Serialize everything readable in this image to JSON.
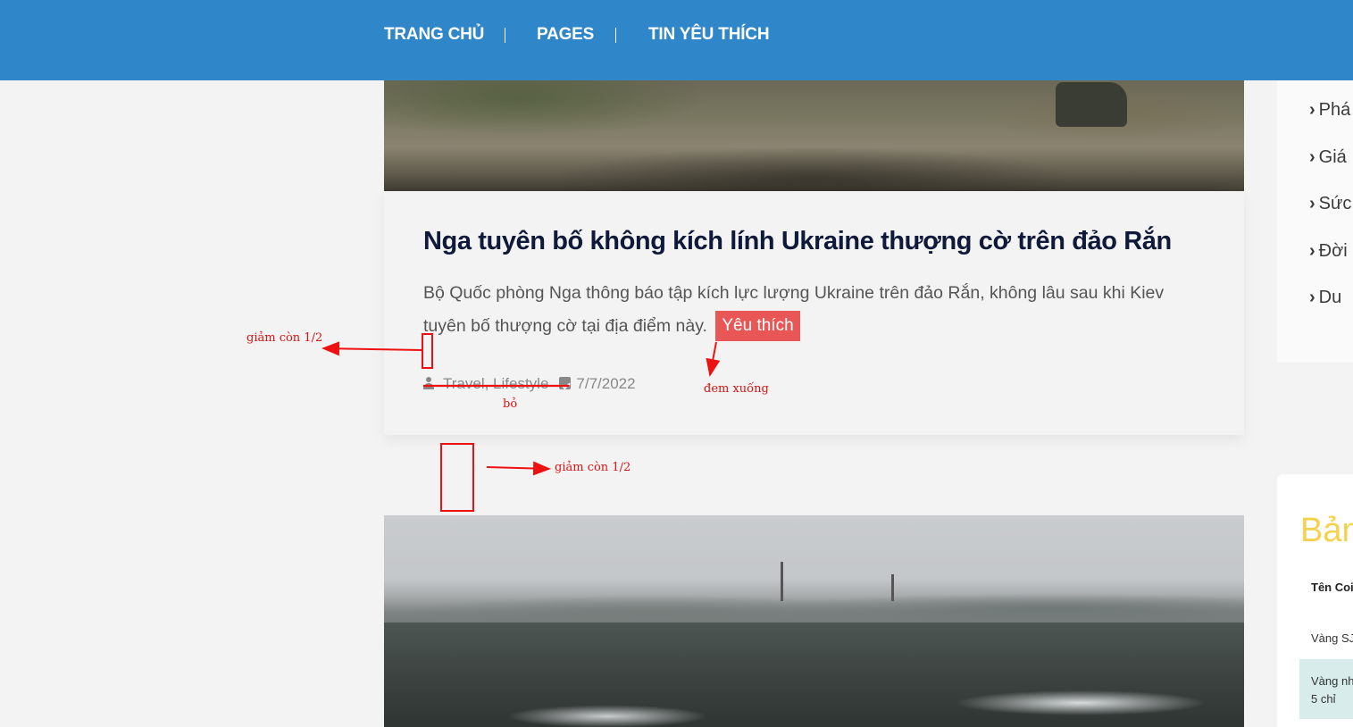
{
  "nav": {
    "items": [
      "TRANG CHỦ",
      "PAGES",
      "TIN YÊU THÍCH"
    ]
  },
  "article": {
    "title": "Nga tuyên bố không kích lính Ukraine thượng cờ trên đảo Rắn",
    "excerpt": "Bộ Quốc phòng Nga thông báo tập kích lực lượng Ukraine trên đảo Rắn, không lâu sau khi Kiev tuyên bố thượng cờ tại địa điểm này.",
    "favorite_label": "Yêu thích",
    "categories": "Travel, Lifestyle",
    "date": "7/7/2022"
  },
  "sidebar": {
    "items": [
      "Phá",
      "Giá",
      "Sức",
      "Đời",
      "Du"
    ],
    "widget_title": "Bản",
    "table_header": "Tên Coi",
    "row1": "Vàng SJ",
    "row2_line1": "Vàng nh",
    "row2_line2": "5 chỉ"
  },
  "annotations": {
    "reduce_half_1": "giảm còn 1/2",
    "remove": "bỏ",
    "move_down": "đem xuống",
    "reduce_half_2": "giảm còn 1/2"
  },
  "colors": {
    "nav_bg": "#2f86c8",
    "favorite_bg": "#e85656",
    "annotation": "#d91313",
    "widget_title": "#f5d24e"
  }
}
